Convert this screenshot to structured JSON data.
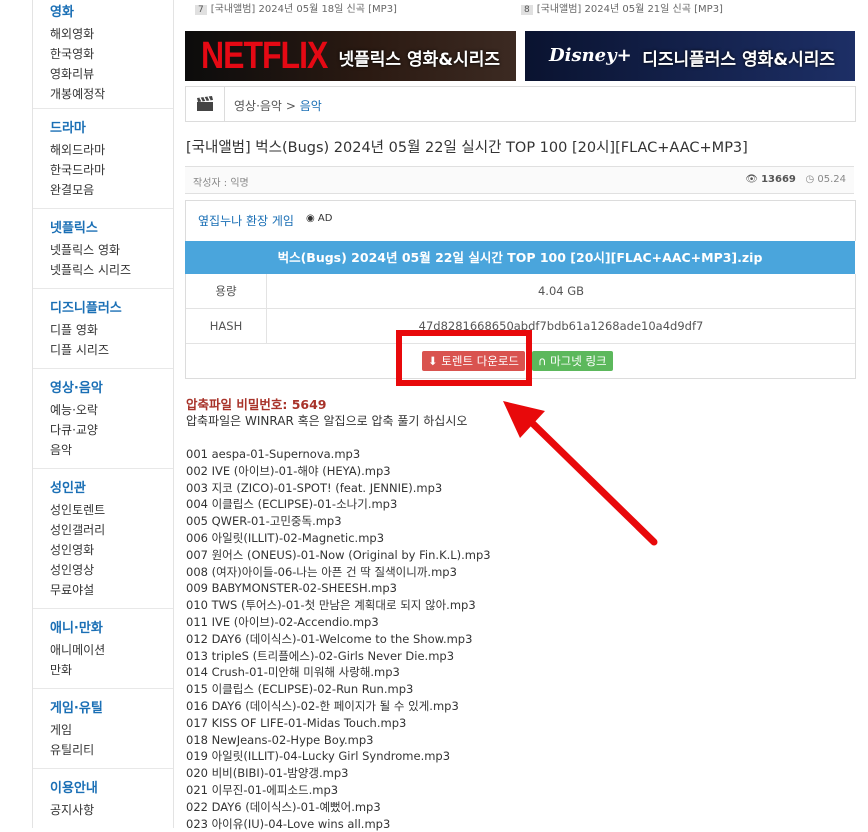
{
  "sidebar": {
    "sections": [
      {
        "head": "영화",
        "items": [
          "해외영화",
          "한국영화",
          "영화리뷰",
          "개봉예정작"
        ]
      },
      {
        "head": "드라마",
        "items": [
          "해외드라마",
          "한국드라마",
          "완결모음"
        ]
      },
      {
        "head": "넷플릭스",
        "items": [
          "넷플릭스 영화",
          "넷플릭스 시리즈"
        ]
      },
      {
        "head": "디즈니플러스",
        "items": [
          "디플 영화",
          "디플 시리즈"
        ]
      },
      {
        "head": "영상·음악",
        "items": [
          "예능·오락",
          "다큐·교양",
          "음악"
        ]
      },
      {
        "head": "성인관",
        "items": [
          "성인토렌트",
          "성인갤러리",
          "성인영화",
          "성인영상",
          "무료야설"
        ]
      },
      {
        "head": "애니·만화",
        "items": [
          "애니메이션",
          "만화"
        ]
      },
      {
        "head": "게임·유틸",
        "items": [
          "게임",
          "유틸리티"
        ]
      },
      {
        "head": "이용안내",
        "items": [
          "공지사항"
        ]
      }
    ]
  },
  "recent": [
    {
      "num": "7",
      "text": "[국내앨범] 2024년 05월 18일 신곡 [MP3]"
    },
    {
      "num": "8",
      "text": "[국내앨범] 2024년 05월 21일 신곡 [MP3]"
    }
  ],
  "banners": {
    "netflix_logo": "NETFLIX",
    "netflix_title": "넷플릭스 영화&시리즈",
    "disney_logo": "Disney+",
    "disney_title": "디즈니플러스 영화&시리즈"
  },
  "breadcrumb": {
    "parent": "영상·음악",
    "sep": ">",
    "current": "음악"
  },
  "post": {
    "title": "[국내앨범] 벅스(Bugs) 2024년 05월 22일 실시간 TOP 100 [20시][FLAC+AAC+MP3]",
    "author": "작성자 : 익명",
    "views": "13669",
    "date": "05.24"
  },
  "ad": {
    "link": "옆집누나 환장 게임",
    "tag": "AD"
  },
  "file": {
    "name": "벅스(Bugs) 2024년 05월 22일 실시간 TOP 100 [20시][FLAC+AAC+MP3].zip",
    "size_label": "용량",
    "size": "4.04 GB",
    "hash_label": "HASH",
    "hash": "47d8281668650abdf7bdb61a1268ade10a4d9df7",
    "torrent_btn": "토렌트 다운로드",
    "magnet_btn": "마그넷 링크"
  },
  "password": "압축파일 비밀번호: 5649",
  "password_note": "압축파일은 WINRAR 혹은 알집으로 압축 풀기 하십시오",
  "tracks": [
    "001 aespa-01-Supernova.mp3",
    "002 IVE (아이브)-01-해야 (HEYA).mp3",
    "003 지코 (ZICO)-01-SPOT! (feat. JENNIE).mp3",
    "004 이클립스 (ECLIPSE)-01-소나기.mp3",
    "005 QWER-01-고민중독.mp3",
    "006 아일릿(ILLIT)-02-Magnetic.mp3",
    "007 원어스 (ONEUS)-01-Now (Original by Fin.K.L).mp3",
    "008 (여자)아이들-06-나는 아픈 건 딱 질색이니까.mp3",
    "009 BABYMONSTER-02-SHEESH.mp3",
    "010 TWS (투어스)-01-첫 만남은 계획대로 되지 않아.mp3",
    "011 IVE (아이브)-02-Accendio.mp3",
    "012 DAY6 (데이식스)-01-Welcome to the Show.mp3",
    "013 tripleS (트리플에스)-02-Girls Never Die.mp3",
    "014 Crush-01-미안해 미워해 사랑해.mp3",
    "015 이클립스 (ECLIPSE)-02-Run Run.mp3",
    "016 DAY6 (데이식스)-02-한 페이지가 될 수 있게.mp3",
    "017 KISS OF LIFE-01-Midas Touch.mp3",
    "018 NewJeans-02-Hype Boy.mp3",
    "019 아일릿(ILLIT)-04-Lucky Girl Syndrome.mp3",
    "020 비비(BIBI)-01-밤양갱.mp3",
    "021 이무진-01-에피소드.mp3",
    "022 DAY6 (데이식스)-01-예뻤어.mp3",
    "023 아이유(IU)-04-Love wins all.mp3"
  ],
  "colors": {
    "accent": "#1a6fb5",
    "filehead": "#4aa5dc",
    "torrent": "#d9534f",
    "magnet": "#5cb85c",
    "annotation": "#e8090b"
  }
}
